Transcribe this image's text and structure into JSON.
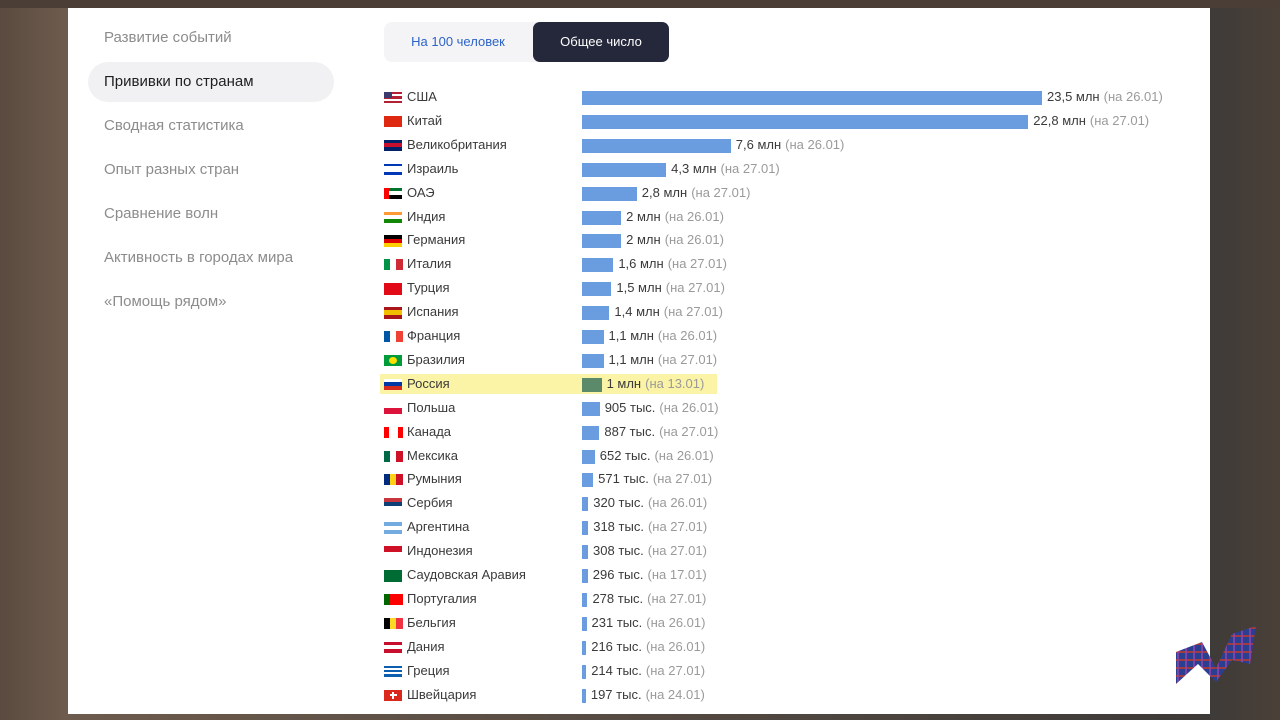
{
  "sidebar": {
    "items": [
      {
        "label": "Развитие событий"
      },
      {
        "label": "Прививки по странам",
        "active": true
      },
      {
        "label": "Сводная статистика"
      },
      {
        "label": "Опыт разных стран"
      },
      {
        "label": "Сравнение волн"
      },
      {
        "label": "Активность в городах мира"
      },
      {
        "label": "«Помощь рядом»"
      }
    ]
  },
  "tabs": [
    {
      "label": "На 100 человек"
    },
    {
      "label": "Общее число",
      "active": true
    }
  ],
  "colors": {
    "bar": "#6a9ce0",
    "highlight_bar": "#5b8a6a",
    "highlight_bg": "#fbf3a6",
    "active_tab": "#25283a"
  },
  "chart_data": {
    "type": "bar",
    "orientation": "horizontal",
    "highlight": "Россия",
    "categories": [
      "США",
      "Китай",
      "Великобритания",
      "Израиль",
      "ОАЭ",
      "Индия",
      "Германия",
      "Италия",
      "Турция",
      "Испания",
      "Франция",
      "Бразилия",
      "Россия",
      "Польша",
      "Канада",
      "Мексика",
      "Румыния",
      "Сербия",
      "Аргентина",
      "Индонезия",
      "Саудовская Аравия",
      "Португалия",
      "Бельгия",
      "Дания",
      "Греция",
      "Швейцария"
    ],
    "values": [
      23500000,
      22800000,
      7600000,
      4300000,
      2800000,
      2000000,
      2000000,
      1600000,
      1500000,
      1400000,
      1100000,
      1100000,
      1000000,
      905000,
      887000,
      652000,
      571000,
      320000,
      318000,
      308000,
      296000,
      278000,
      231000,
      216000,
      214000,
      197000
    ],
    "value_labels": [
      "23,5 млн",
      "22,8 млн",
      "7,6 млн",
      "4,3 млн",
      "2,8 млн",
      "2 млн",
      "2 млн",
      "1,6 млн",
      "1,5 млн",
      "1,4 млн",
      "1,1 млн",
      "1,1 млн",
      "1 млн",
      "905 тыс.",
      "887 тыс.",
      "652 тыс.",
      "571 тыс.",
      "320 тыс.",
      "318 тыс.",
      "308 тыс.",
      "296 тыс.",
      "278 тыс.",
      "231 тыс.",
      "216 тыс.",
      "214 тыс.",
      "197 тыс."
    ],
    "dates": [
      "(на 26.01)",
      "(на 27.01)",
      "(на 26.01)",
      "(на 27.01)",
      "(на 27.01)",
      "(на 26.01)",
      "(на 26.01)",
      "(на 27.01)",
      "(на 27.01)",
      "(на 27.01)",
      "(на 26.01)",
      "(на 27.01)",
      "(на 13.01)",
      "(на 26.01)",
      "(на 27.01)",
      "(на 26.01)",
      "(на 27.01)",
      "(на 26.01)",
      "(на 27.01)",
      "(на 27.01)",
      "(на 17.01)",
      "(на 27.01)",
      "(на 26.01)",
      "(на 26.01)",
      "(на 27.01)",
      "(на 24.01)"
    ],
    "flags": [
      {
        "stripes": [
          "#b22234",
          "#ffffff",
          "#b22234",
          "#ffffff",
          "#b22234"
        ],
        "canton": "#3c3b6e"
      },
      {
        "stripes": [
          "#de2910"
        ]
      },
      {
        "stripes": [
          "#012169",
          "#c8102e",
          "#012169"
        ]
      },
      {
        "stripes": [
          "#0038b8",
          "#ffffff",
          "#ffffff",
          "#0038b8"
        ]
      },
      {
        "stripes": [
          "#00732f",
          "#ffffff",
          "#000000"
        ],
        "canton": "#ff0000",
        "canton_w": 0.25
      },
      {
        "stripes": [
          "#ff9933",
          "#ffffff",
          "#138808"
        ]
      },
      {
        "stripes": [
          "#000000",
          "#dd0000",
          "#ffce00"
        ]
      },
      {
        "vstripes": [
          "#009246",
          "#ffffff",
          "#ce2b37"
        ]
      },
      {
        "stripes": [
          "#e30a17"
        ]
      },
      {
        "stripes": [
          "#aa151b",
          "#f1bf00",
          "#f1bf00",
          "#aa151b"
        ]
      },
      {
        "vstripes": [
          "#0055a4",
          "#ffffff",
          "#ef4135"
        ]
      },
      {
        "stripes": [
          "#009c3b"
        ],
        "dot": "#ffdf00"
      },
      {
        "stripes": [
          "#ffffff",
          "#0039a6",
          "#d52b1e"
        ]
      },
      {
        "stripes": [
          "#ffffff",
          "#dc143c"
        ]
      },
      {
        "vstripes": [
          "#ff0000",
          "#ffffff",
          "#ffffff",
          "#ff0000"
        ]
      },
      {
        "vstripes": [
          "#006847",
          "#ffffff",
          "#ce1126"
        ]
      },
      {
        "vstripes": [
          "#002b7f",
          "#fcd116",
          "#ce1126"
        ]
      },
      {
        "stripes": [
          "#c6363c",
          "#0c4076",
          "#ffffff"
        ]
      },
      {
        "stripes": [
          "#74acdf",
          "#ffffff",
          "#74acdf"
        ]
      },
      {
        "stripes": [
          "#ce1126",
          "#ffffff"
        ]
      },
      {
        "stripes": [
          "#006c35"
        ]
      },
      {
        "vstripes": [
          "#006600",
          "#ff0000",
          "#ff0000"
        ]
      },
      {
        "vstripes": [
          "#000000",
          "#fdda24",
          "#ef3340"
        ]
      },
      {
        "stripes": [
          "#c8102e",
          "#ffffff",
          "#c8102e"
        ]
      },
      {
        "stripes": [
          "#0d5eaf",
          "#ffffff",
          "#0d5eaf",
          "#ffffff",
          "#0d5eaf"
        ]
      },
      {
        "stripes": [
          "#da291c"
        ],
        "cross": "#ffffff"
      }
    ]
  }
}
